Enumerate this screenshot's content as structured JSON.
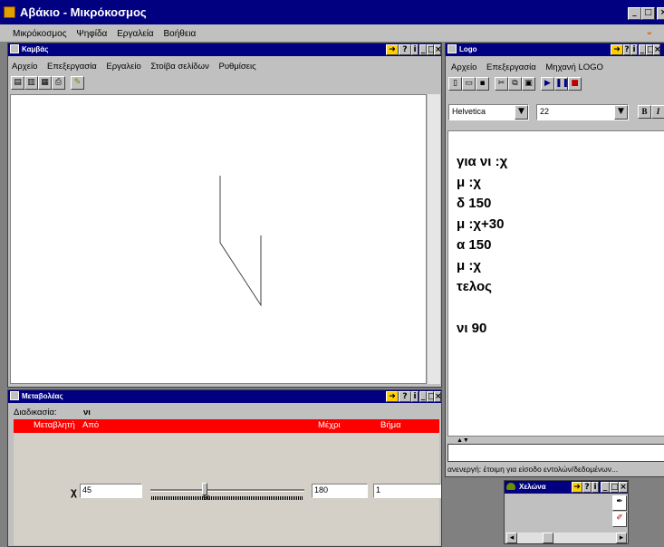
{
  "app": {
    "title": "Αβάκιο - Μικρόκοσμος",
    "menu": [
      "Μικρόκοσμος",
      "Ψηφίδα",
      "Εργαλεία",
      "Βοήθεια"
    ]
  },
  "canvas_window": {
    "title": "Καμβάς",
    "menu": [
      "Αρχείο",
      "Επεξεργασία",
      "Εργαλείο",
      "Στοίβα σελίδων",
      "Ρυθμίσεις"
    ]
  },
  "logo_window": {
    "title": "Logo",
    "menu": [
      "Αρχείο",
      "Επεξεργασία",
      "Μηχανή LOGO"
    ],
    "font": "Helvetica",
    "size": "22",
    "code_lines": [
      "για νι :χ",
      "μ :χ",
      "δ 150",
      "μ :χ+30",
      "α 150",
      "μ :χ",
      "τελος",
      "",
      "νι 90"
    ],
    "status": "ανενεργή: έτοιμη για είσοδο εντολών/δεδομένων..."
  },
  "variator_window": {
    "title": "Μεταβολέας",
    "procedure_label": "Διαδικασία:",
    "procedure_value": "νι",
    "headers": {
      "variable": "Μεταβλητή",
      "from": "Από",
      "to": "Μέχρι",
      "step": "Βήμα"
    },
    "row": {
      "var": "χ",
      "from": "45",
      "slider_value": "90",
      "to": "180",
      "step": "1"
    }
  },
  "turtle_window": {
    "title": "Χελώνα"
  },
  "colors": {
    "titlebar": "#000080",
    "header_red": "#ff0000",
    "face": "#c0c0c0"
  }
}
